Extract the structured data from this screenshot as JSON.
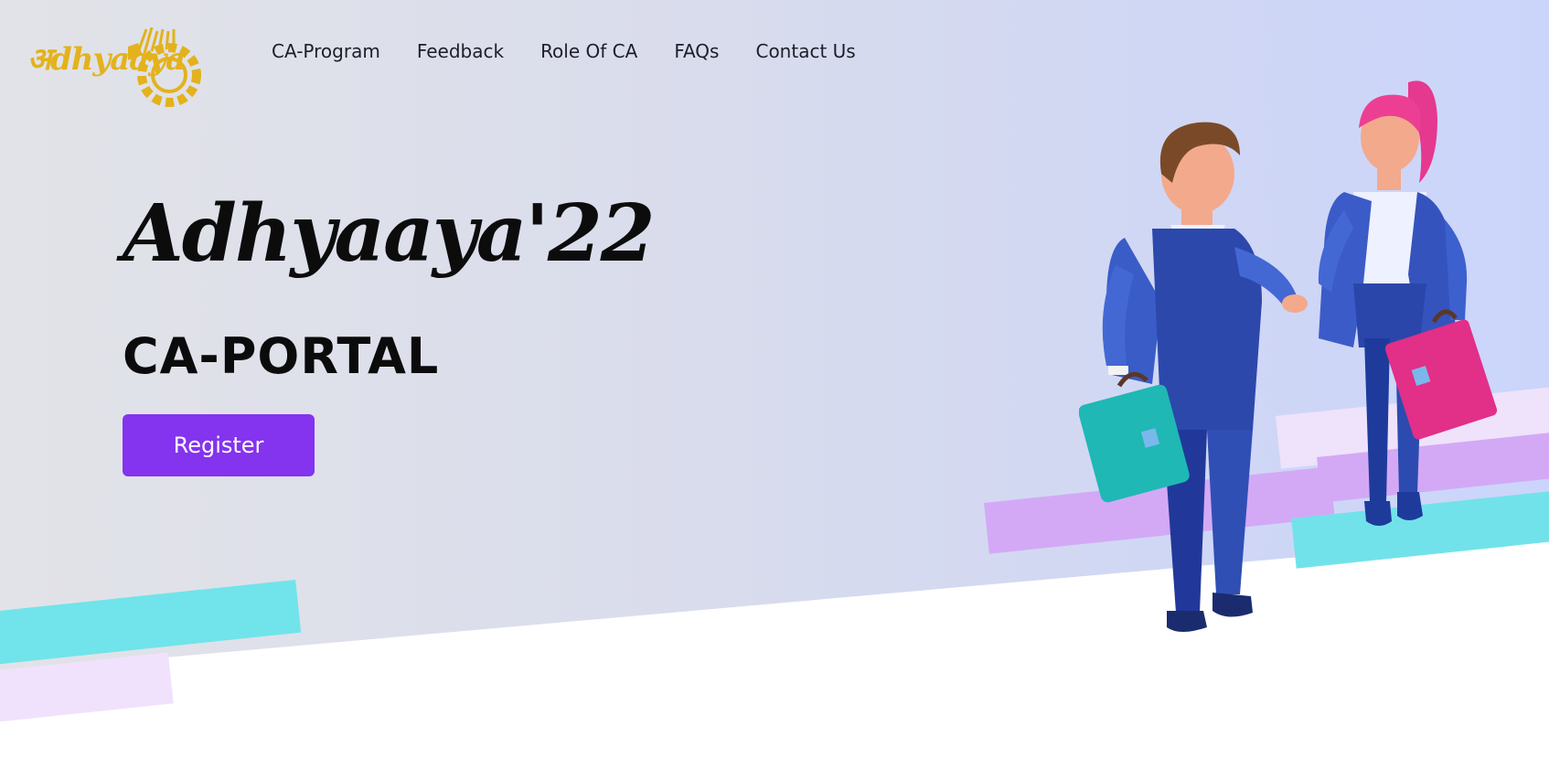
{
  "brand": {
    "logo_text": "अdhyaaya",
    "logo_color": "#e3b21c"
  },
  "nav": {
    "items": [
      {
        "label": "CA-Program"
      },
      {
        "label": "Feedback"
      },
      {
        "label": "Role Of CA"
      },
      {
        "label": "FAQs"
      },
      {
        "label": "Contact Us"
      }
    ]
  },
  "hero": {
    "title": "Adhyaaya'22",
    "subtitle": "CA-PORTAL",
    "register_label": "Register",
    "register_color": "#8433ee"
  },
  "illustration": {
    "icon": "business-handshake-illustration"
  }
}
